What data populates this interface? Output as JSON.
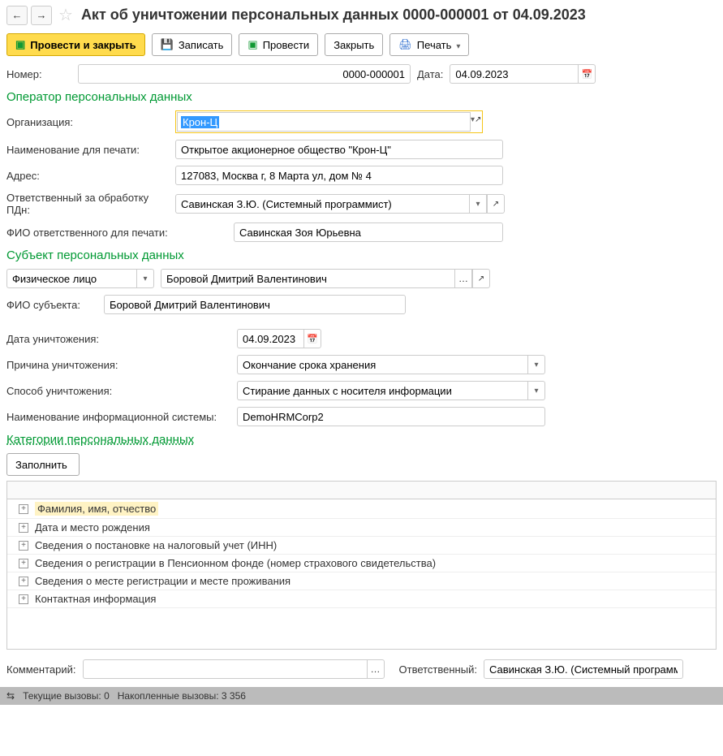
{
  "header": {
    "title": "Акт об уничтожении персональных данных 0000-000001 от 04.09.2023"
  },
  "toolbar": {
    "post_close": "Провести и закрыть",
    "save": "Записать",
    "post": "Провести",
    "close": "Закрыть",
    "print": "Печать"
  },
  "form": {
    "number_label": "Номер:",
    "number_value": "0000-000001",
    "date_label": "Дата:",
    "date_value": "04.09.2023"
  },
  "operator": {
    "title": "Оператор персональных данных",
    "org_label": "Организация:",
    "org_value": "Крон-Ц",
    "print_name_label": "Наименование для печати:",
    "print_name_value": "Открытое акционерное общество \"Крон-Ц\"",
    "address_label": "Адрес:",
    "address_value": "127083, Москва г, 8 Марта ул, дом № 4",
    "responsible_label": "Ответственный за обработку ПДн:",
    "responsible_value": "Савинская З.Ю. (Системный программист)",
    "resp_print_label": "ФИО ответственного для печати:",
    "resp_print_value": "Савинская Зоя Юрьевна"
  },
  "subject": {
    "title": "Субъект персональных данных",
    "type_value": "Физическое лицо",
    "person_value": "Боровой Дмитрий Валентинович",
    "fio_label": "ФИО субъекта:",
    "fio_value": "Боровой Дмитрий Валентинович"
  },
  "destruction": {
    "date_label": "Дата уничтожения:",
    "date_value": "04.09.2023",
    "reason_label": "Причина уничтожения:",
    "reason_value": "Окончание срока хранения",
    "method_label": "Способ уничтожения:",
    "method_value": "Стирание данных с носителя информации",
    "system_label": "Наименование информационной системы:",
    "system_value": "DemoHRMCorp2"
  },
  "categories": {
    "title": "Категории персональных данных",
    "fill_btn": "Заполнить",
    "items": [
      "Фамилия, имя, отчество",
      "Дата и место рождения",
      "Сведения о постановке на налоговый учет (ИНН)",
      "Сведения о регистрации в Пенсионном фонде (номер страхового свидетельства)",
      "Сведения о месте регистрации и месте проживания",
      "Контактная информация"
    ]
  },
  "footer": {
    "comment_label": "Комментарий:",
    "responsible_label": "Ответственный:",
    "responsible_value": "Савинская З.Ю. (Системный программист)"
  },
  "status": {
    "current": "Текущие вызовы: 0",
    "accum": "Накопленные вызовы: 3 356"
  }
}
